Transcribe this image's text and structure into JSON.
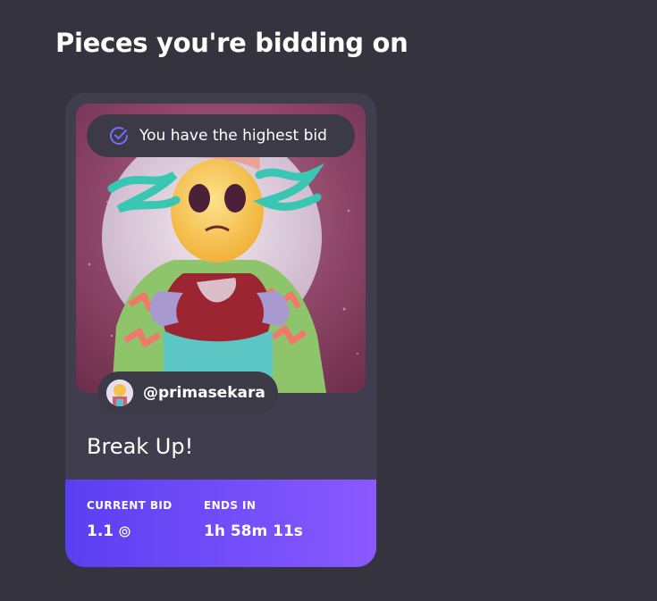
{
  "section": {
    "title": "Pieces you're bidding on"
  },
  "card": {
    "status": "You have the highest bid",
    "creator": "@primasekara",
    "title": "Break Up!",
    "current_bid_label": "CURRENT BID",
    "current_bid_value": "1.1",
    "currency_icon": "target-circle-icon",
    "ends_in_label": "ENDS IN",
    "ends_in_value": "1h 58m 11s"
  },
  "colors": {
    "background": "#35333e",
    "card": "#403d4e",
    "accent_start": "#5a3ff2",
    "accent_end": "#8a59ff",
    "check": "#7b6cff"
  }
}
